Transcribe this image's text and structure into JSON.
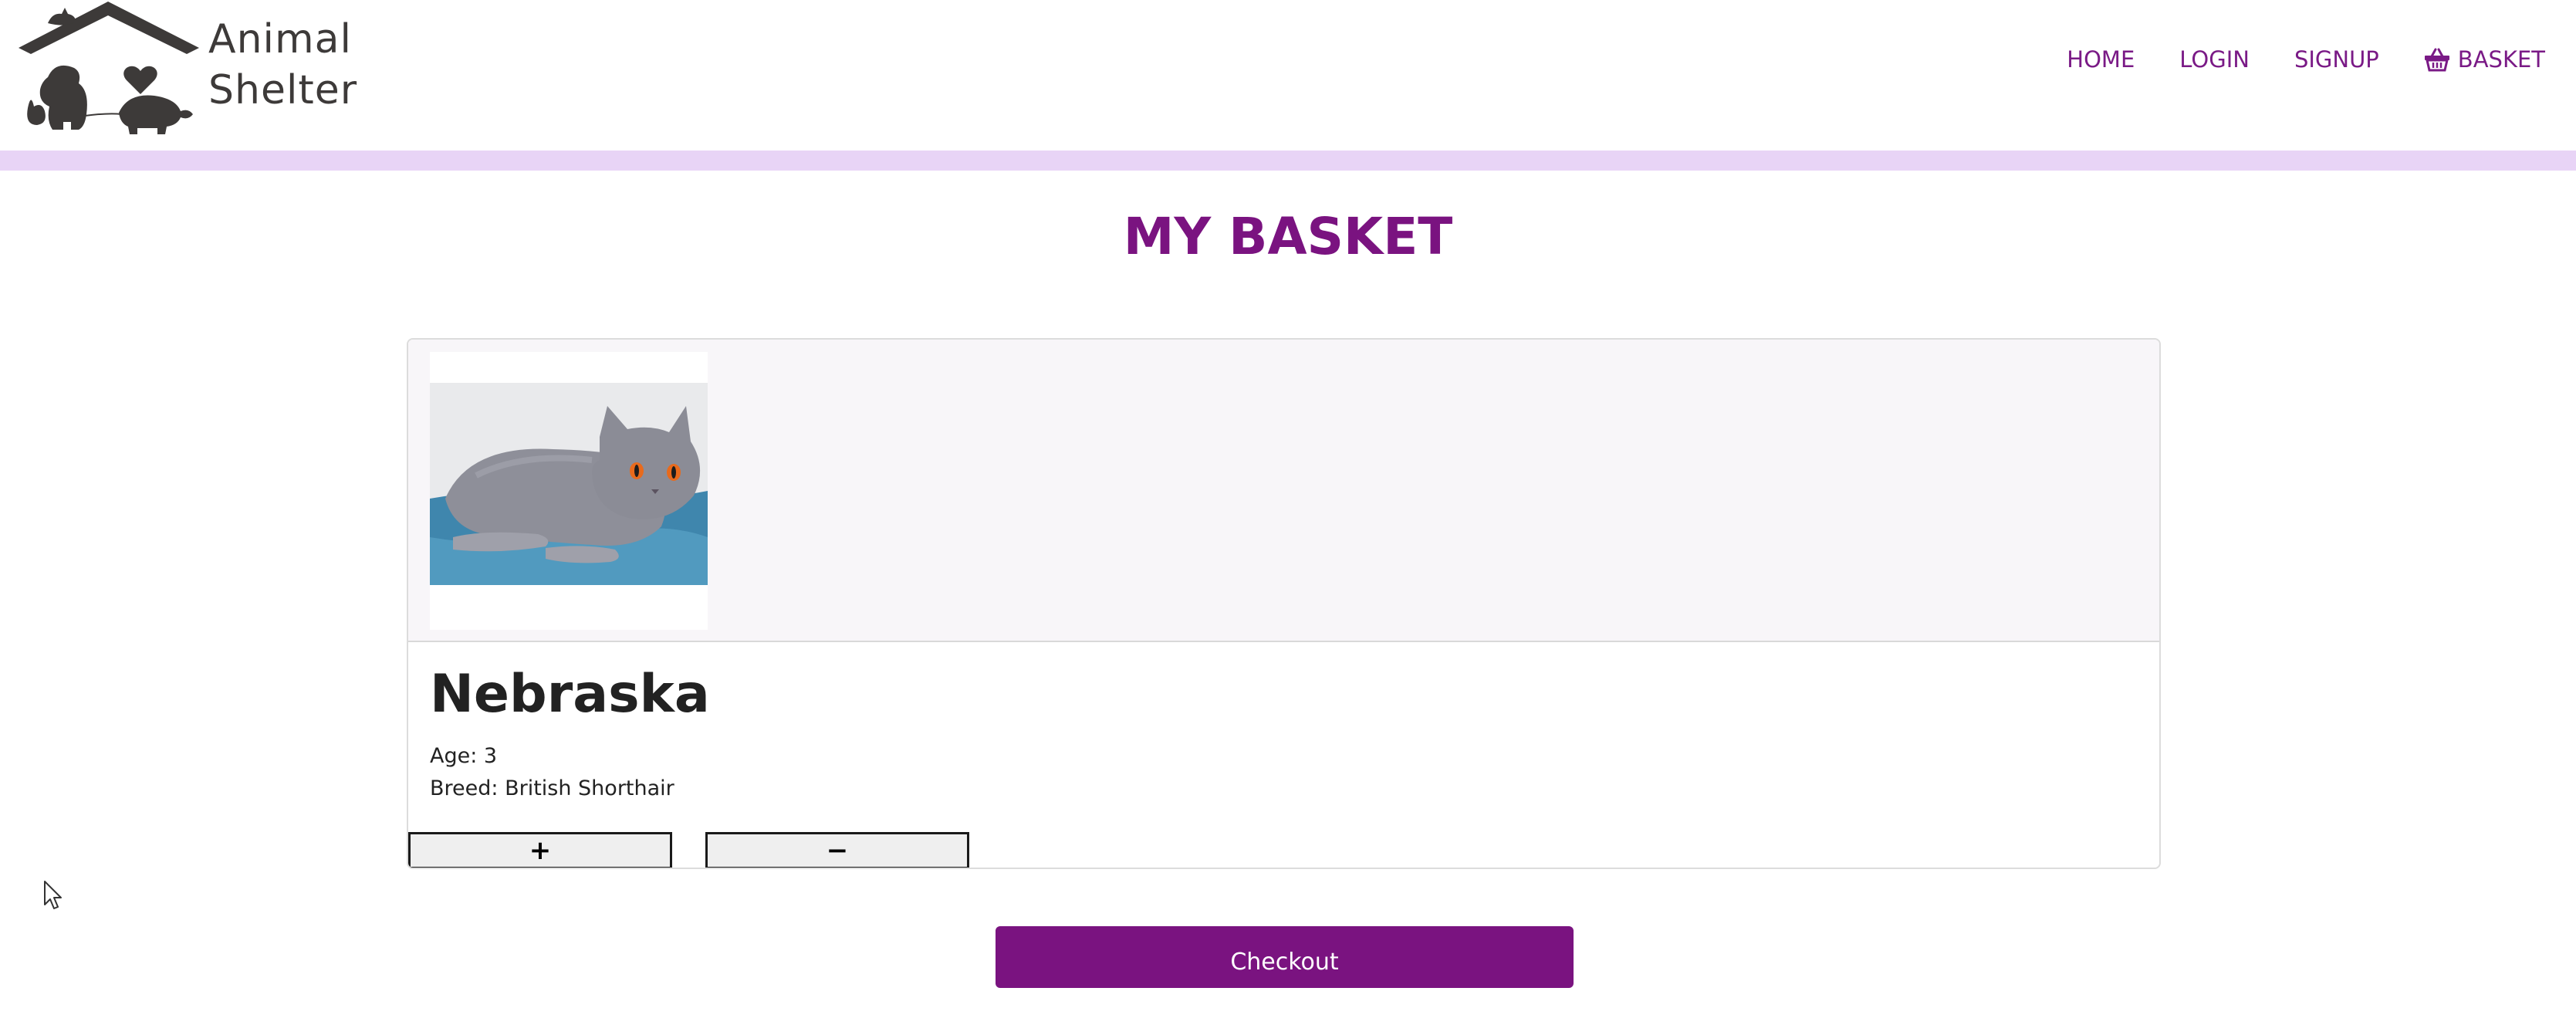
{
  "brand": {
    "name_line1": "Animal",
    "name_line2": "Shelter",
    "logo_icon": "house-with-pets-icon",
    "logo_color": "#3d3a39"
  },
  "nav": {
    "items": [
      {
        "label": "HOME"
      },
      {
        "label": "LOGIN"
      },
      {
        "label": "SIGNUP"
      },
      {
        "label": "BASKET",
        "icon": "basket-icon"
      }
    ],
    "link_color": "#7a1a86"
  },
  "page": {
    "title": "MY BASKET",
    "accent_color": "#7a1380",
    "band_color": "#e8d4f6"
  },
  "basket": {
    "items": [
      {
        "name": "Nebraska",
        "age": "Age: 3",
        "breed": "Breed: British Shorthair",
        "photo": "grey-cat-photo",
        "increase_label": "+",
        "decrease_label": "−"
      }
    ]
  },
  "checkout": {
    "label": "Checkout"
  }
}
